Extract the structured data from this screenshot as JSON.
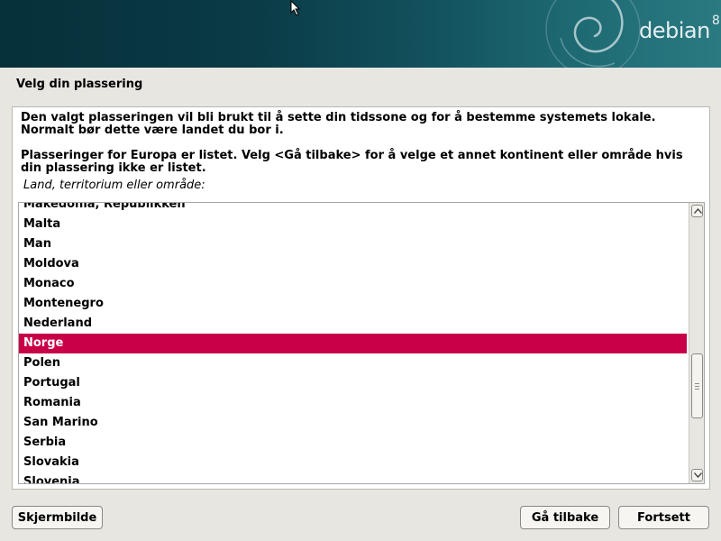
{
  "header": {
    "brand": "debian",
    "version": "8",
    "colors": {
      "banner_dark": "#06303a",
      "banner_light": "#2a7a82"
    }
  },
  "page": {
    "title": "Velg din plassering"
  },
  "content": {
    "description_1": "Den valgt plasseringen vil bli brukt til å sette din tidssone og for å bestemme systemets lokale. Normalt bør dette være landet du bor i.",
    "description_2": "Plasseringer for Europa er listet. Velg <Gå tilbake> for å velge et annet kontinent eller område hvis din plassering ikke er listet.",
    "field_label": "Land, territorium eller område:"
  },
  "country_list": {
    "items": [
      "Makedonia, Republikken",
      "Malta",
      "Man",
      "Moldova",
      "Monaco",
      "Montenegro",
      "Nederland",
      "Norge",
      "Polen",
      "Portugal",
      "Romania",
      "San Marino",
      "Serbia",
      "Slovakia",
      "Slovenia"
    ],
    "selected": "Norge",
    "selected_color": "#c80048"
  },
  "footer": {
    "screenshot_label": "Skjermbilde",
    "back_label": "Gå tilbake",
    "continue_label": "Fortsett"
  }
}
